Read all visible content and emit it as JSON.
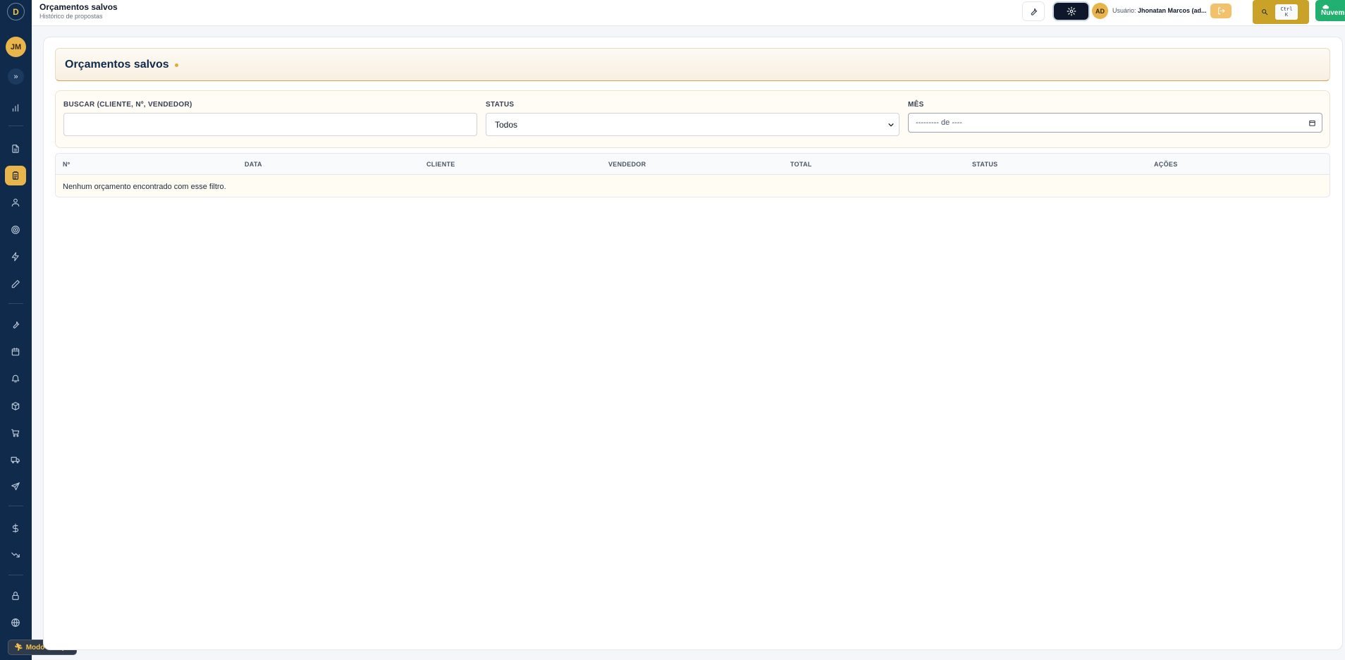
{
  "sidebar": {
    "logo_letter": "D",
    "avatar_initials": "JM",
    "expand_glyph": "»",
    "items": [
      {
        "icon": "bar-chart-icon"
      },
      {
        "icon": "document-icon"
      },
      {
        "icon": "clipboard-icon",
        "active": true
      },
      {
        "icon": "user-icon"
      },
      {
        "icon": "target-icon"
      },
      {
        "icon": "lightning-icon"
      },
      {
        "icon": "pencil-icon"
      },
      {
        "icon": "wrench-icon"
      },
      {
        "icon": "calendar-icon"
      },
      {
        "icon": "bell-icon"
      },
      {
        "icon": "box-icon"
      },
      {
        "icon": "cart-icon"
      },
      {
        "icon": "truck-icon"
      },
      {
        "icon": "send-icon"
      },
      {
        "icon": "dollar-icon"
      },
      {
        "icon": "trending-down-icon"
      },
      {
        "icon": "lock-icon"
      },
      {
        "icon": "globe-icon"
      }
    ],
    "modo_campo_label": "Modo Campo"
  },
  "header": {
    "title": "Orçamentos salvos",
    "subtitle": "Histórico de propostas",
    "user_avatar": "AD",
    "user_prefix": "Usuário:",
    "user_name": "Jhonatan Marcos (ad...",
    "kbd_line1": "Ctrl",
    "kbd_line2": "K",
    "nuvem_label": "Nuvem"
  },
  "page": {
    "title": "Orçamentos salvos"
  },
  "filters": {
    "search_label": "BUSCAR (CLIENTE, Nº, VENDEDOR)",
    "search_value": "",
    "status_label": "STATUS",
    "status_value": "Todos",
    "month_label": "MÊS",
    "month_value": "--------- de ----"
  },
  "table": {
    "columns": [
      "Nº",
      "DATA",
      "CLIENTE",
      "VENDEDOR",
      "TOTAL",
      "STATUS",
      "AÇÕES"
    ],
    "empty_message": "Nenhum orçamento encontrado com esse filtro."
  },
  "colors": {
    "sidebar_bg": "#0f2a4a",
    "accent_gold": "#e8b44c",
    "nuvem_green": "#22b070"
  }
}
